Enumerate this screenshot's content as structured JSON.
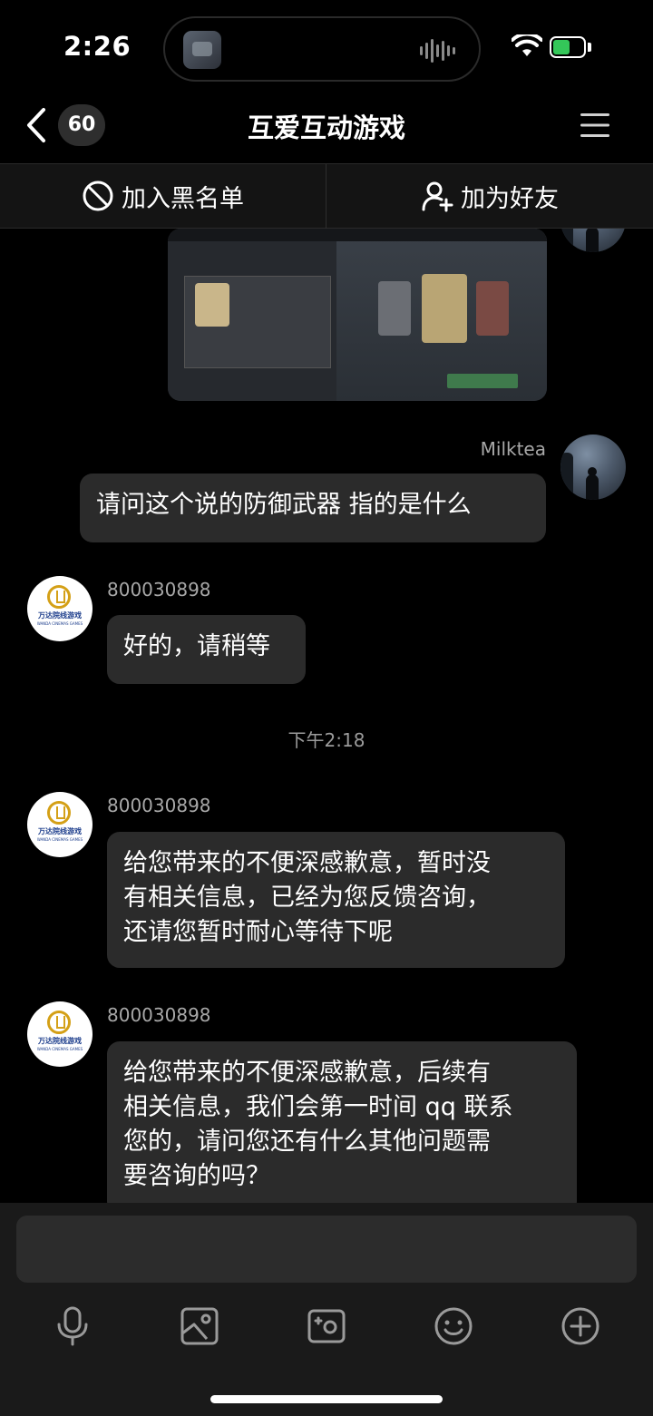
{
  "status_bar": {
    "time": "2:26",
    "battery_level": 0.55
  },
  "nav": {
    "back_count": "60",
    "title": "互爱互动游戏"
  },
  "actions": {
    "blacklist": "加入黑名单",
    "add_friend": "加为好友"
  },
  "messages": [
    {
      "type": "image",
      "from": "self"
    },
    {
      "type": "text",
      "from": "self",
      "sender": "Milktea",
      "text": "请问这个说的防御武器 指的是什么"
    },
    {
      "type": "text",
      "from": "agent",
      "sender": "800030898",
      "text": "好的，请稍等"
    },
    {
      "type": "text",
      "from": "agent",
      "sender": "800030898",
      "lines": [
        "给您带来的不便深感歉意，暂时没",
        "有相关信息，已经为您反馈咨询，",
        "还请您暂时耐心等待下呢"
      ]
    },
    {
      "type": "text",
      "from": "agent",
      "sender": "800030898",
      "lines": [
        "给您带来的不便深感歉意，后续有",
        "相关信息，我们会第一时间 qq 联系",
        "您的，请问您还有什么其他问题需",
        "要咨询的吗？"
      ]
    }
  ],
  "timestamp": "下午2:18",
  "agent_avatar": {
    "cn": "万达院线游戏",
    "en": "WANDA CINEMAS GAMES"
  },
  "toolbar": {
    "icons": [
      "microphone-icon",
      "image-icon",
      "camera-icon",
      "emoji-icon",
      "plus-icon"
    ]
  }
}
